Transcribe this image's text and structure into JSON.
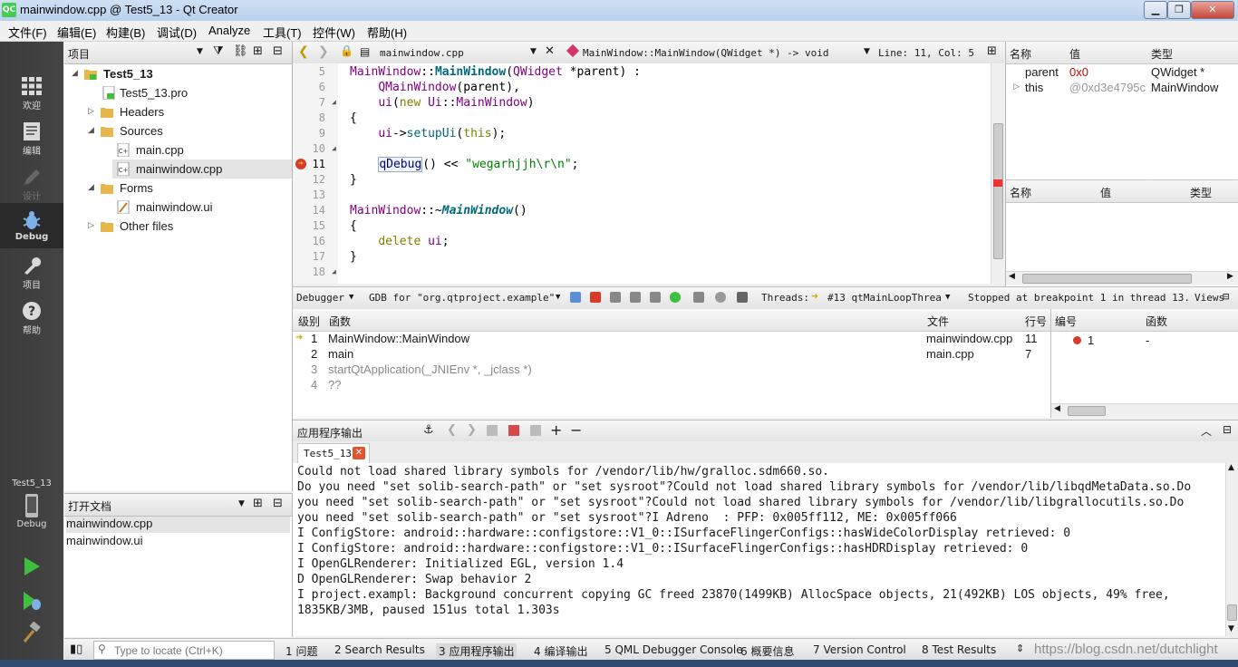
{
  "window": {
    "title": "mainwindow.cpp @ Test5_13 - Qt Creator",
    "logo": "QC"
  },
  "menu": [
    "文件(F)",
    "编辑(E)",
    "构建(B)",
    "调试(D)",
    "Analyze",
    "工具(T)",
    "控件(W)",
    "帮助(H)"
  ],
  "modes": {
    "welcome": "欢迎",
    "edit": "编辑",
    "design": "设计",
    "debug": "Debug",
    "projects": "项目",
    "help": "帮助",
    "target_project": "Test5_13",
    "target_mode": "Debug"
  },
  "project_panel": {
    "title": "项目",
    "tree": {
      "root": "Test5_13",
      "pro": "Test5_13.pro",
      "headers": "Headers",
      "sources": "Sources",
      "main_cpp": "main.cpp",
      "mainwindow_cpp": "mainwindow.cpp",
      "forms": "Forms",
      "mainwindow_ui": "mainwindow.ui",
      "other": "Other files"
    }
  },
  "open_docs": {
    "title": "打开文档",
    "items": [
      "mainwindow.cpp",
      "mainwindow.ui"
    ]
  },
  "editor_toolbar": {
    "file": "mainwindow.cpp",
    "symbol": "MainWindow::MainWindow(QWidget *) -> void",
    "position": "Line: 11, Col: 5"
  },
  "editor": {
    "line_numbers": [
      "5",
      "6",
      "7",
      "8",
      "9",
      "10",
      "11",
      "12",
      "13",
      "14",
      "15",
      "16",
      "17",
      "18"
    ]
  },
  "locals": {
    "headers": [
      "名称",
      "值",
      "类型"
    ],
    "rows": [
      {
        "name": "parent",
        "value": "0x0",
        "type": "QWidget *"
      },
      {
        "name": "this",
        "value": "@0xd3e4795c",
        "type": "MainWindow"
      }
    ],
    "watch_headers": [
      "名称",
      "值",
      "类型"
    ]
  },
  "debugger_toolbar": {
    "debugger": "Debugger",
    "engine": "GDB for \"org.qtproject.example\"",
    "threads_label": "Threads:",
    "thread": "#13 qtMainLoopThrea",
    "status": "Stopped at breakpoint 1 in thread 13.",
    "views": "Views"
  },
  "stack": {
    "headers": {
      "level": "级别",
      "function": "函数",
      "file": "文件",
      "line": "行号"
    },
    "rows": [
      {
        "level": "1",
        "function": "MainWindow::MainWindow",
        "file": "mainwindow.cpp",
        "line": "11"
      },
      {
        "level": "2",
        "function": "main",
        "file": "main.cpp",
        "line": "7"
      },
      {
        "level": "3",
        "function": "startQtApplication(_JNIEnv *, _jclass *)",
        "file": "",
        "line": ""
      },
      {
        "level": "4",
        "function": "??",
        "file": "",
        "line": ""
      }
    ]
  },
  "breakpoints": {
    "headers": {
      "number": "编号",
      "function": "函数"
    },
    "rows": [
      {
        "number": "1",
        "function": "-"
      }
    ]
  },
  "output": {
    "title": "应用程序输出",
    "tab": "Test5_13",
    "lines": [
      "Could not load shared library symbols for /vendor/lib/hw/gralloc.sdm660.so.",
      "Do you need \"set solib-search-path\" or \"set sysroot\"?Could not load shared library symbols for /vendor/lib/libqdMetaData.so.Do",
      "you need \"set solib-search-path\" or \"set sysroot\"?Could not load shared library symbols for /vendor/lib/libgrallocutils.so.Do",
      "you need \"set solib-search-path\" or \"set sysroot\"?I Adreno  : PFP: 0x005ff112, ME: 0x005ff066",
      "I ConfigStore: android::hardware::configstore::V1_0::ISurfaceFlingerConfigs::hasWideColorDisplay retrieved: 0",
      "I ConfigStore: android::hardware::configstore::V1_0::ISurfaceFlingerConfigs::hasHDRDisplay retrieved: 0",
      "I OpenGLRenderer: Initialized EGL, version 1.4",
      "D OpenGLRenderer: Swap behavior 2",
      "I project.exampl: Background concurrent copying GC freed 23870(1499KB) AllocSpace objects, 21(492KB) LOS objects, 49% free,",
      "1835KB/3MB, paused 151us total 1.303s"
    ]
  },
  "bottom": {
    "locator_placeholder": "Type to locate (Ctrl+K)",
    "panes": [
      "1 问题",
      "2 Search Results",
      "3 应用程序输出",
      "4 编译输出",
      "5 QML Debugger Console",
      "6 概要信息",
      "7 Version Control",
      "8 Test Results"
    ],
    "watermark": "https://blog.csdn.net/dutchlight"
  }
}
